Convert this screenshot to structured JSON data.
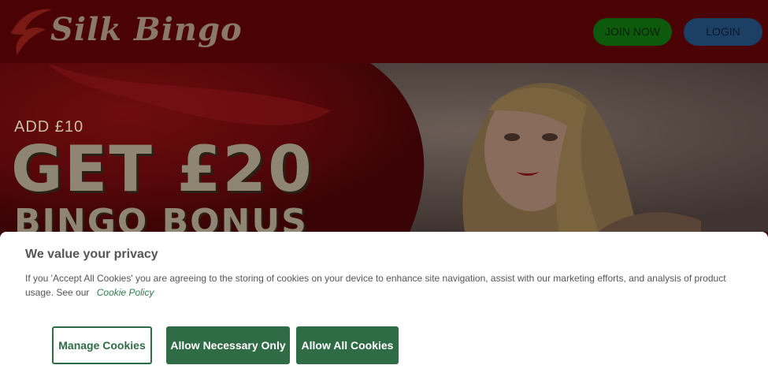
{
  "header": {
    "logo_text": "Silk Bingo",
    "join_label": "JOIN NOW",
    "login_label": "LOGIN"
  },
  "hero": {
    "promo_small": "ADD £10",
    "promo_big": "GET £20",
    "promo_sub": "BINGO BONUS"
  },
  "cookie_banner": {
    "title": "We value your privacy",
    "text": "If you 'Accept All Cookies' you are agreeing to the storing of cookies on your device to enhance site navigation, assist with our marketing efforts, and analysis of product usage. See our",
    "link_label": "Cookie Policy",
    "manage_label": "Manage Cookies",
    "necessary_label": "Allow Necessary Only",
    "allow_all_label": "Allow All Cookies"
  },
  "colors": {
    "header_bg": "#4a0205",
    "join_button": "#0d5a0d",
    "login_button": "#1c3f66",
    "cookie_accent": "#2f6b45"
  }
}
